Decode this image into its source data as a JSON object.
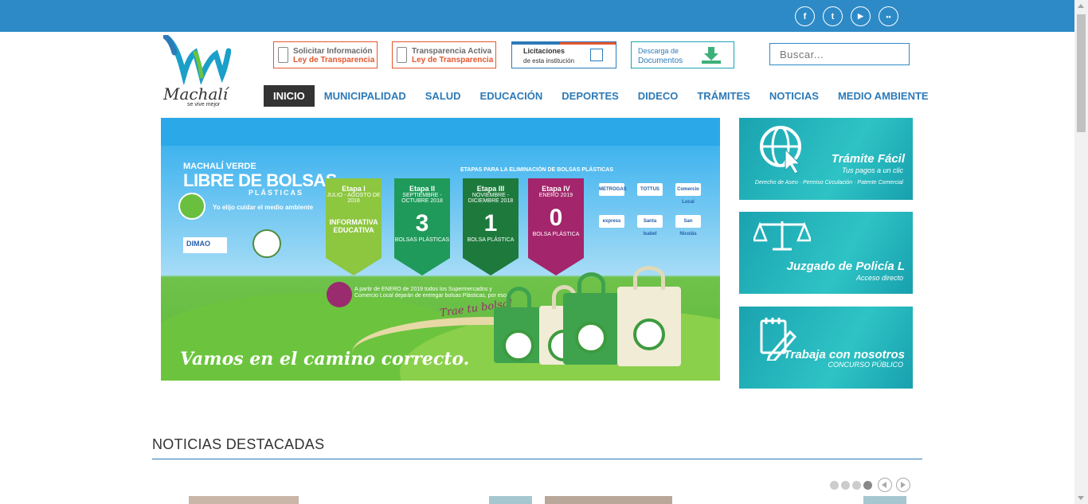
{
  "social": [
    {
      "name": "facebook-icon",
      "glyph": "f"
    },
    {
      "name": "twitter-icon",
      "glyph": "t"
    },
    {
      "name": "youtube-icon",
      "glyph": "▶"
    },
    {
      "name": "flickr-icon",
      "glyph": "••"
    }
  ],
  "logo": {
    "name": "Machalí",
    "tagline": "se vive mejor"
  },
  "header_buttons": {
    "solicitar": {
      "line1": "Solicitar Información",
      "line2": "Ley de Transparencia"
    },
    "transparencia": {
      "line1": "Transparencia Activa",
      "line2": "Ley de Transparencia"
    },
    "licitaciones": {
      "line1": "Licitaciones",
      "line2": "de esta institución"
    },
    "descarga": {
      "line1": "Descarga de",
      "line2": "Documentos"
    }
  },
  "search": {
    "placeholder": "Buscar..."
  },
  "nav": [
    "INICIO",
    "MUNICIPALIDAD",
    "SALUD",
    "EDUCACIÓN",
    "DEPORTES",
    "DIDECO",
    "TRÁMITES",
    "NOTICIAS",
    "MEDIO AMBIENTE"
  ],
  "banner": {
    "title_small": "MACHALÍ VERDE",
    "title_big": "LIBRE DE BOLSAS",
    "title_sub": "PLÁSTICAS",
    "subtitle": "Yo elijo cuidar el medio ambiente",
    "dimao": "DIMAO",
    "etapas_header": "ETAPAS PARA LA ELIMINACIÓN DE BOLSAS PLÁSTICAS",
    "stages": [
      {
        "title": "Etapa I",
        "dates": "JULIO - AGOSTO DE 2018",
        "big": "INFORMATIVA EDUCATIVA",
        "foot": "",
        "color": "#8dc63f"
      },
      {
        "title": "Etapa II",
        "dates": "SEPTIEMBRE - OCTUBRE 2018",
        "big": "3",
        "foot": "BOLSAS PLÁSTICAS",
        "color": "#1f9a5a"
      },
      {
        "title": "Etapa III",
        "dates": "NOVIEMBRE - DICIEMBRE 2018",
        "big": "1",
        "foot": "BOLSA PLÁSTICA",
        "color": "#1d7a3c"
      },
      {
        "title": "Etapa IV",
        "dates": "ENERO 2019",
        "big": "0",
        "foot": "BOLSA PLÁSTICA",
        "color": "#a3256b"
      }
    ],
    "partir_text": "A partir de ENERO de 2019 todos los Supermercados y Comercio Local dejarán de entregar bolsas Plásticas, por eso...",
    "trae": "Trae tu bolsa!",
    "slogan": "Vamos en el camino correcto.",
    "sponsors": [
      "METROGAS",
      "TOTTUS",
      "Comercio Local",
      "express",
      "Santa Isabel",
      "San Nicolás"
    ]
  },
  "side_cards": [
    {
      "title": "Trámite Fácil",
      "subtitle": "Tus pagos a un clic",
      "footer": "Derecho de Aseo · Permiso Circulación · Patente Comercial",
      "icon": "globe-cursor-icon"
    },
    {
      "title": "Juzgado de Policía L",
      "subtitle": "Acceso directo",
      "footer": "",
      "icon": "scales-icon"
    },
    {
      "title": "Trabaja con nosotros",
      "subtitle": "CONCURSO PÚBLICO",
      "footer": "",
      "icon": "notepad-pen-icon"
    }
  ],
  "news": {
    "title": "NOTICIAS DESTACADAS"
  },
  "colors": {
    "brand_blue": "#2d8ac7",
    "nav_blue": "#2d7ab8",
    "orange": "#e4572e",
    "teal": "#1aa3b0"
  }
}
